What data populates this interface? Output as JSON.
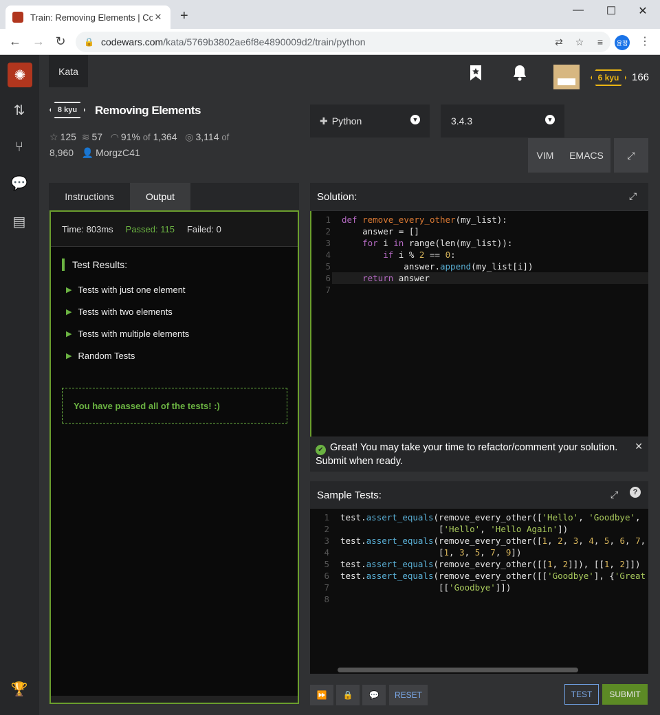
{
  "browser": {
    "tab_title": "Train: Removing Elements | Cod",
    "url_host": "codewars.com",
    "url_path": "/kata/5769b3802ae6f8e4890009d2/train/python",
    "profile_label": "윤정"
  },
  "header": {
    "kata_tab": "Kata",
    "rank": "6 kyu",
    "honor": "166"
  },
  "kata": {
    "kyu": "8 kyu",
    "title": "Removing Elements",
    "stars": "125",
    "collections": "57",
    "satisfaction": "91%",
    "of_label": "of",
    "votes": "1,364",
    "completed": "3,114",
    "total": "8,960",
    "author": "MorgzC41"
  },
  "editor": {
    "language": "Python",
    "version": "3.4.3",
    "modes": [
      "VIM",
      "EMACS"
    ]
  },
  "tabs": [
    "Instructions",
    "Output"
  ],
  "output": {
    "time": "Time: 803ms",
    "passed": "Passed: 115",
    "failed": "Failed: 0",
    "results_heading": "Test Results:",
    "tests": [
      "Tests with just one element",
      "Tests with two elements",
      "Tests with multiple elements",
      "Random Tests"
    ],
    "passed_message": "You have passed all of the tests! :)"
  },
  "solution": {
    "title": "Solution:",
    "line_numbers": [
      "1",
      "2",
      "3",
      "4",
      "5",
      "6",
      "7"
    ]
  },
  "alert": {
    "message": "Great! You may take your time to refactor/comment your solution. Submit when ready."
  },
  "sample_tests": {
    "title": "Sample Tests:",
    "line_numbers": [
      "1",
      "2",
      "3",
      "4",
      "5",
      "6",
      "7",
      "8"
    ]
  },
  "buttons": {
    "reset": "RESET",
    "test": "TEST",
    "submit": "SUBMIT"
  }
}
